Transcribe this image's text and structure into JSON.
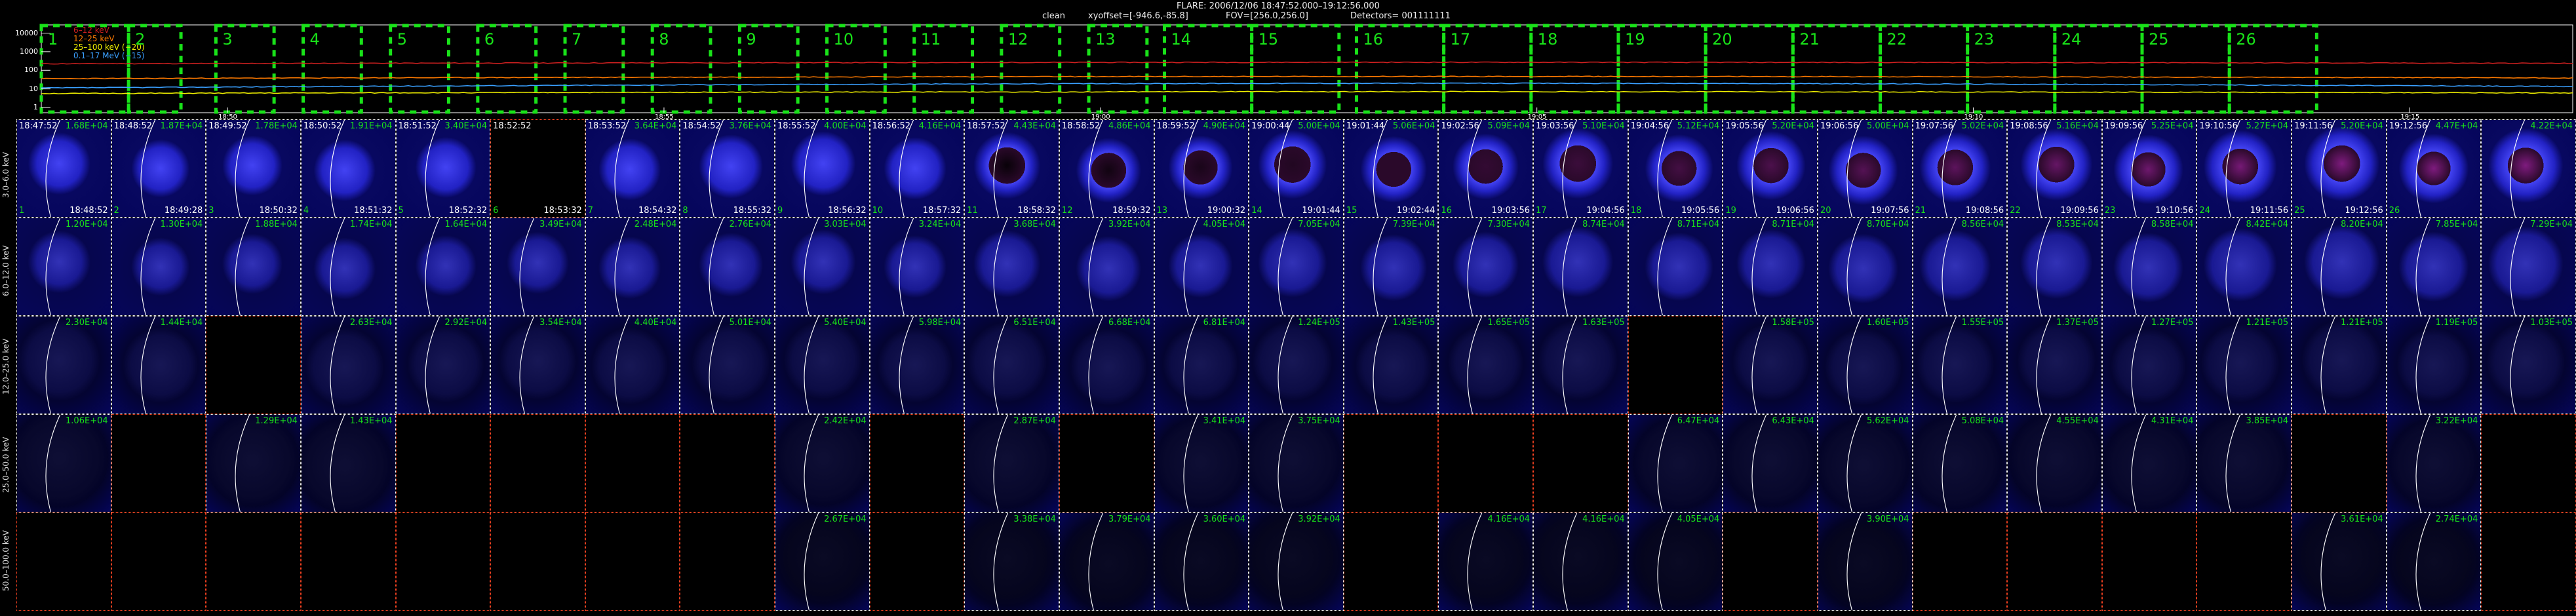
{
  "header": {
    "title": "FLARE: 2006/12/06 18:47:52.000–19:12:56.000",
    "method": "clean",
    "xyoffset": "xyoffset=[-946.6,-85.8]",
    "fov": "FOV=[256.0,256.0]",
    "detectors": "Detectors= 001111111"
  },
  "lightcurve": {
    "legend": [
      {
        "label": "6–12 keV",
        "color": "#d02020"
      },
      {
        "label": "12–25 keV",
        "color": "#ff7a00"
      },
      {
        "label": "25–100 keV (−20)",
        "color": "#f0f000"
      },
      {
        "label": "0.1–17 MeV (−15)",
        "color": "#3aa0ff"
      }
    ],
    "y_ticks": [
      "10000",
      "1000",
      "100",
      "10",
      "1"
    ],
    "x_ticks": [
      "18:50",
      "18:55",
      "19:00",
      "19:05",
      "19:10",
      "19:15"
    ],
    "interval_labels": [
      "1",
      "2",
      "3",
      "4",
      "5",
      "6",
      "7",
      "8",
      "9",
      "10",
      "11",
      "12",
      "13",
      "14",
      "15",
      "16",
      "17",
      "18",
      "19",
      "20",
      "21",
      "22",
      "23",
      "24",
      "25",
      "26"
    ],
    "interval_color": "#19e219"
  },
  "rows": [
    {
      "energy": "3.0–6.0 keV",
      "values": [
        "1.68E+04",
        "1.87E+04",
        "1.78E+04",
        "1.91E+04",
        "3.40E+04",
        "",
        "3.64E+04",
        "3.76E+04",
        "4.00E+04",
        "4.16E+04",
        "4.43E+04",
        "4.86E+04",
        "4.90E+04",
        "5.00E+04",
        "5.06E+04",
        "5.09E+04",
        "5.10E+04",
        "5.12E+04",
        "5.20E+04",
        "5.00E+04",
        "5.02E+04",
        "5.16E+04",
        "5.25E+04",
        "5.27E+04",
        "5.20E+04",
        "4.47E+04",
        "4.22E+04"
      ]
    },
    {
      "energy": "6.0–12.0 keV",
      "values": [
        "1.20E+04",
        "1.30E+04",
        "1.88E+04",
        "1.74E+04",
        "1.64E+04",
        "3.49E+04",
        "2.48E+04",
        "2.76E+04",
        "3.03E+04",
        "3.24E+04",
        "3.68E+04",
        "3.92E+04",
        "4.05E+04",
        "7.05E+04",
        "7.39E+04",
        "7.30E+04",
        "8.74E+04",
        "8.71E+04",
        "8.71E+04",
        "8.70E+04",
        "8.56E+04",
        "8.53E+04",
        "8.58E+04",
        "8.42E+04",
        "8.20E+04",
        "7.85E+04",
        "7.29E+04"
      ]
    },
    {
      "energy": "12.0–25.0 keV",
      "values": [
        "2.30E+04",
        "1.44E+04",
        "",
        "2.63E+04",
        "2.92E+04",
        "3.54E+04",
        "4.40E+04",
        "5.01E+04",
        "5.40E+04",
        "5.98E+04",
        "6.51E+04",
        "6.68E+04",
        "6.81E+04",
        "1.24E+05",
        "1.43E+05",
        "1.65E+05",
        "1.63E+05",
        "",
        "1.58E+05",
        "1.60E+05",
        "1.55E+05",
        "1.37E+05",
        "1.27E+05",
        "1.21E+05",
        "1.21E+05",
        "1.19E+05",
        "1.03E+05"
      ]
    },
    {
      "energy": "25.0–50.0 keV",
      "values": [
        "1.06E+04",
        "",
        "1.29E+04",
        "1.43E+04",
        "",
        "",
        "",
        "",
        "2.42E+04",
        "",
        "2.87E+04",
        "",
        "3.41E+04",
        "3.75E+04",
        "",
        "",
        "",
        "6.47E+04",
        "6.43E+04",
        "5.62E+04",
        "5.08E+04",
        "4.55E+04",
        "4.31E+04",
        "3.85E+04",
        "",
        "3.22E+04",
        ""
      ]
    },
    {
      "energy": "50.0–100.0 keV",
      "values": [
        "",
        "",
        "",
        "",
        "",
        "",
        "",
        "",
        "2.67E+04",
        "",
        "3.38E+04",
        "3.79E+04",
        "3.60E+04",
        "3.92E+04",
        "",
        "4.16E+04",
        "4.16E+04",
        "4.05E+04",
        "",
        "3.90E+04",
        "",
        "",
        "",
        "",
        "3.61E+04",
        "2.74E+04",
        ""
      ]
    }
  ],
  "start_times": [
    "18:47:52",
    "18:48:52",
    "18:49:52",
    "18:50:52",
    "18:51:52",
    "18:52:52",
    "18:53:52",
    "18:54:52",
    "18:55:52",
    "18:56:52",
    "18:57:52",
    "18:58:52",
    "18:59:52",
    "19:00:44",
    "19:01:44",
    "19:02:56",
    "19:03:56",
    "19:04:56",
    "19:05:56",
    "19:06:56",
    "19:07:56",
    "19:08:56",
    "19:09:56",
    "19:10:56",
    "19:11:56",
    "19:12:56"
  ],
  "end_times": [
    "18:48:52",
    "18:49:28",
    "18:50:32",
    "18:51:32",
    "18:52:32",
    "18:53:32",
    "18:54:32",
    "18:55:32",
    "18:56:32",
    "18:57:32",
    "18:58:32",
    "18:59:32",
    "19:00:32",
    "19:01:44",
    "19:02:44",
    "19:03:56",
    "19:04:56",
    "19:05:56",
    "19:06:56",
    "19:07:56",
    "19:08:56",
    "19:09:56",
    "19:10:56",
    "19:11:56",
    "19:12:56"
  ],
  "colors": {
    "time_label": "#ffffff",
    "value_label": "#19e219",
    "index_label": "#19e219",
    "border_empty": "#ff4422",
    "border_data": "#ffffff"
  }
}
